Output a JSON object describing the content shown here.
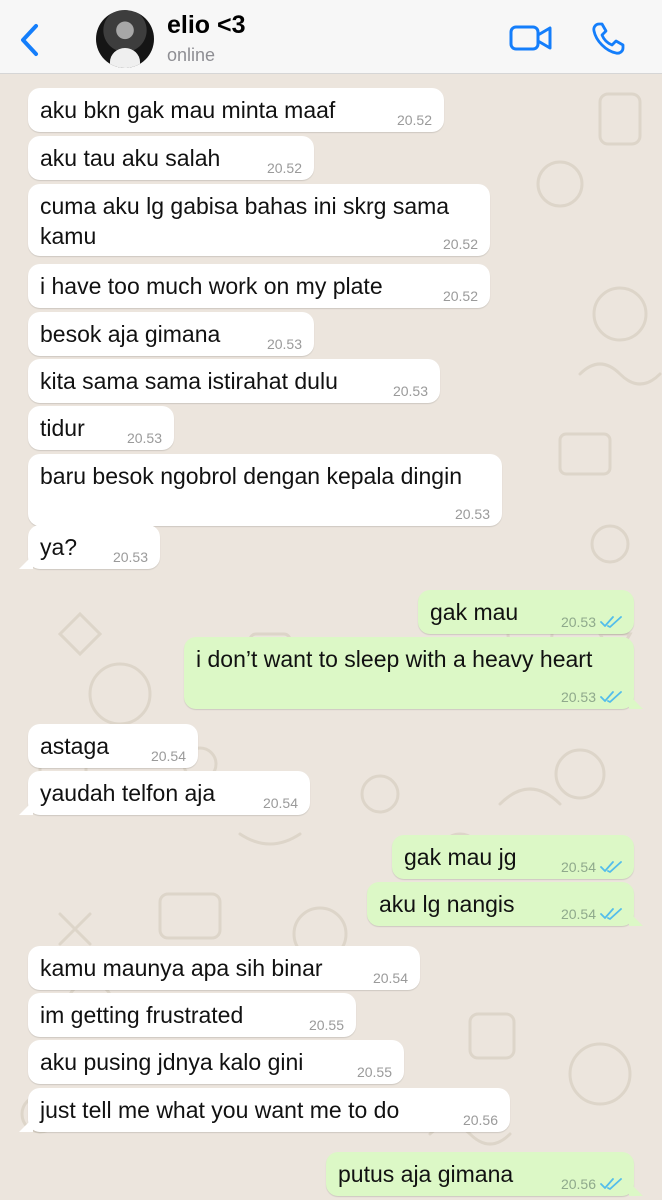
{
  "header": {
    "contact_name": "elio <3",
    "status": "online",
    "icons": {
      "back": "chevron-left-icon",
      "video": "video-camera-icon",
      "call": "phone-icon"
    },
    "accent_color": "#147efb"
  },
  "messages": [
    {
      "direction": "in",
      "text": "aku bkn gak mau minta maaf",
      "time": "20.52"
    },
    {
      "direction": "in",
      "text": "aku tau aku salah",
      "time": "20.52"
    },
    {
      "direction": "in",
      "text": "cuma aku lg gabisa bahas ini skrg sama kamu",
      "time": "20.52"
    },
    {
      "direction": "in",
      "text": "i have too much work on my plate",
      "time": "20.52"
    },
    {
      "direction": "in",
      "text": "besok aja gimana",
      "time": "20.53"
    },
    {
      "direction": "in",
      "text": "kita sama sama istirahat dulu",
      "time": "20.53"
    },
    {
      "direction": "in",
      "text": "tidur",
      "time": "20.53"
    },
    {
      "direction": "in",
      "text": "baru besok ngobrol dengan kepala dingin",
      "time": "20.53"
    },
    {
      "direction": "in",
      "text": "ya?",
      "time": "20.53"
    },
    {
      "direction": "out",
      "text": "gak mau",
      "time": "20.53",
      "read": true
    },
    {
      "direction": "out",
      "text": "i don’t want to sleep with a heavy heart",
      "time": "20.53",
      "read": true
    },
    {
      "direction": "in",
      "text": "astaga",
      "time": "20.54"
    },
    {
      "direction": "in",
      "text": "yaudah telfon aja",
      "time": "20.54"
    },
    {
      "direction": "out",
      "text": "gak mau jg",
      "time": "20.54",
      "read": true
    },
    {
      "direction": "out",
      "text": "aku lg nangis",
      "time": "20.54",
      "read": true
    },
    {
      "direction": "in",
      "text": "kamu maunya apa sih binar",
      "time": "20.54"
    },
    {
      "direction": "in",
      "text": "im getting frustrated",
      "time": "20.55"
    },
    {
      "direction": "in",
      "text": "aku pusing jdnya kalo gini",
      "time": "20.55"
    },
    {
      "direction": "in",
      "text": "just tell me what you want me to do",
      "time": "20.56"
    },
    {
      "direction": "out",
      "text": "putus aja gimana",
      "time": "20.56",
      "read": true
    }
  ],
  "colors": {
    "incoming_bubble": "#ffffff",
    "outgoing_bubble": "#dcf8c6",
    "read_ticks": "#53bdeb",
    "wallpaper": "#ece5dd"
  }
}
